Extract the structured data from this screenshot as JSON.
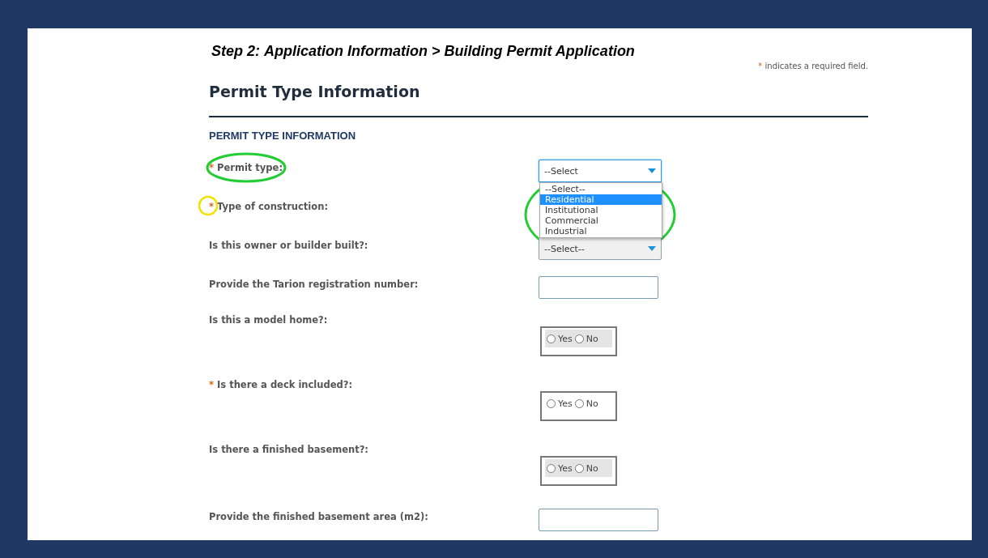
{
  "breadcrumb": {
    "step": "Step 2:",
    "parts": [
      "Application Information",
      ">",
      "Building Permit Application"
    ]
  },
  "required_note": {
    "mark": "*",
    "text": "indicates a required field."
  },
  "page_title": "Permit Type Information",
  "section_title": "PERMIT TYPE INFORMATION",
  "fields": [
    {
      "kind": "select",
      "label": "Permit type:",
      "required_mark": "*",
      "value": "--Select",
      "focused": true,
      "expanded": true,
      "options": [
        {
          "label": "--Select--",
          "selected": false
        },
        {
          "label": "Residential",
          "selected": true
        },
        {
          "label": "Institutional",
          "selected": false
        },
        {
          "label": "Commercial",
          "selected": false
        },
        {
          "label": "Industrial",
          "selected": false
        }
      ]
    },
    {
      "kind": "hidden",
      "label": "Type of construction:",
      "required_mark": "*"
    },
    {
      "kind": "select",
      "label": "Is this owner or builder built?:",
      "value": "--Select--",
      "focused": false
    },
    {
      "kind": "text",
      "label": "Provide the Tarion registration number:"
    },
    {
      "kind": "radio",
      "label": "Is this a model home?:",
      "shaded": true,
      "options": [
        {
          "label": "Yes",
          "checked": false
        },
        {
          "label": "No",
          "checked": false
        }
      ]
    },
    {
      "kind": "radio",
      "label": "Is there a deck included?:",
      "required_mark": "*",
      "shaded": false,
      "options": [
        {
          "label": "Yes",
          "checked": false
        },
        {
          "label": "No",
          "checked": false
        }
      ]
    },
    {
      "kind": "radio",
      "label": "Is there a finished basement?:",
      "shaded": true,
      "options": [
        {
          "label": "Yes",
          "checked": false
        },
        {
          "label": "No",
          "checked": false
        }
      ]
    },
    {
      "kind": "text",
      "label": "Provide the finished basement area (m2):"
    }
  ],
  "annotations": [
    {
      "kind": "ellipse",
      "color": "#22cc33"
    },
    {
      "kind": "circle",
      "color": "#f2e200"
    },
    {
      "kind": "ellipse",
      "color": "#22cc33"
    }
  ]
}
